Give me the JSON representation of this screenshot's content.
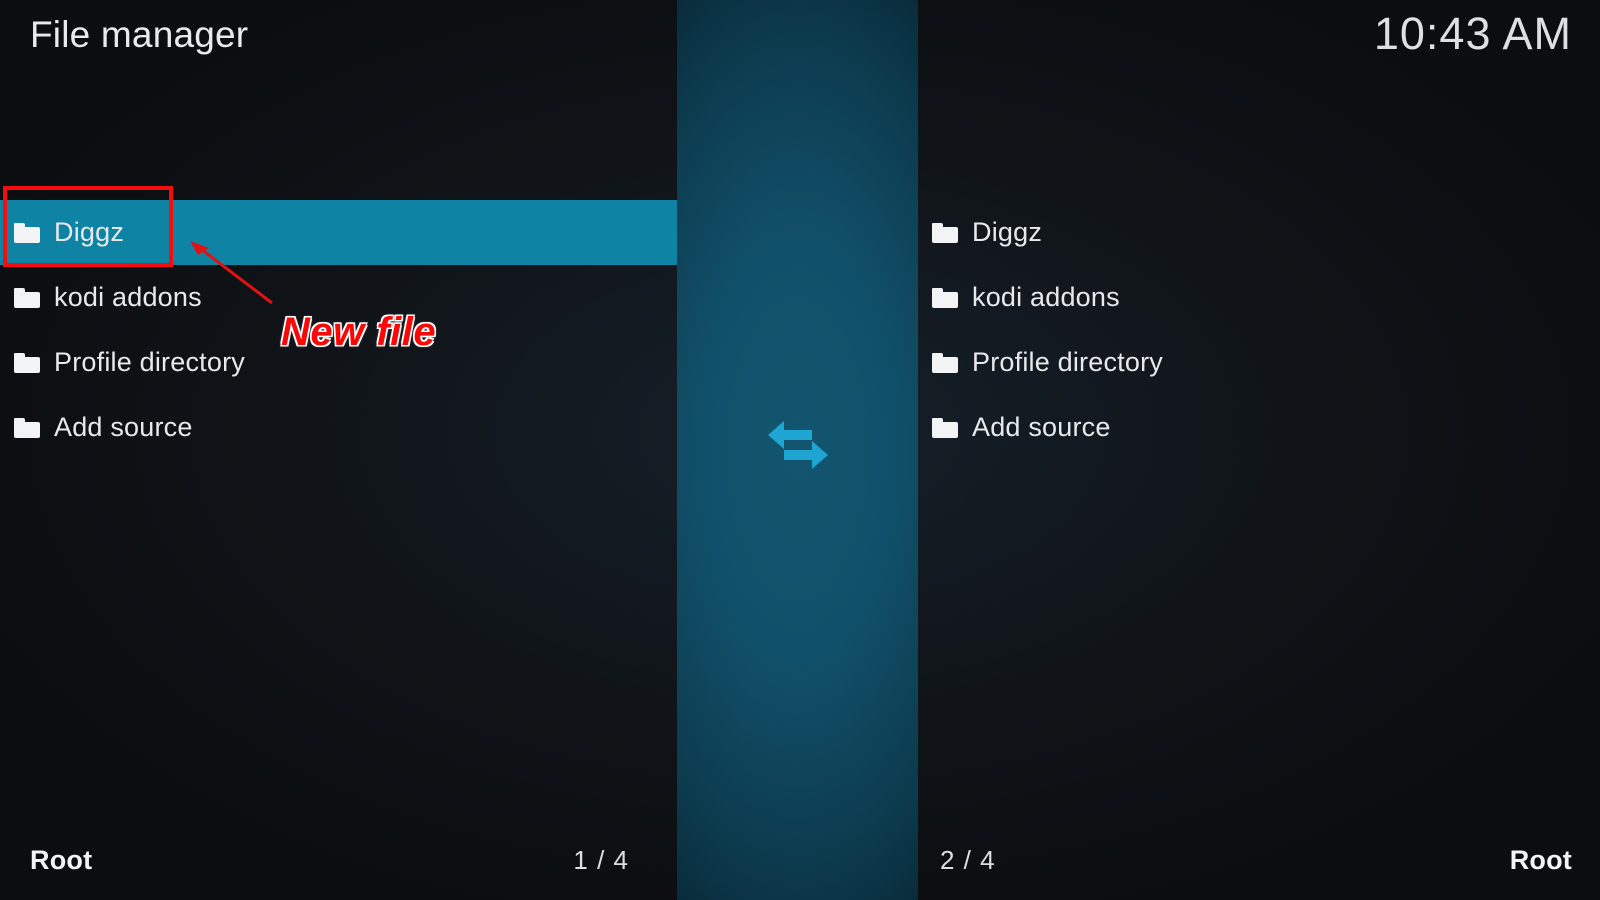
{
  "header": {
    "title": "File manager",
    "clock": "10:43 AM"
  },
  "colors": {
    "selection": "#0e83a3",
    "divider_accent": "#11506a",
    "arrow_icon": "#1fa5d2",
    "annotation": "#fa0808",
    "background": "#101418",
    "text": "#e8e9eb"
  },
  "panels": {
    "left": {
      "items": [
        {
          "label": "Diggz",
          "icon": "folder-icon",
          "selected": true
        },
        {
          "label": "kodi addons",
          "icon": "folder-icon",
          "selected": false
        },
        {
          "label": "Profile directory",
          "icon": "folder-icon",
          "selected": false
        },
        {
          "label": "Add source",
          "icon": "folder-icon",
          "selected": false
        }
      ],
      "footer": {
        "path": "Root",
        "count": "1 / 4"
      }
    },
    "right": {
      "items": [
        {
          "label": "Diggz",
          "icon": "folder-icon",
          "selected": false
        },
        {
          "label": "kodi addons",
          "icon": "folder-icon",
          "selected": false
        },
        {
          "label": "Profile directory",
          "icon": "folder-icon",
          "selected": false
        },
        {
          "label": "Add source",
          "icon": "folder-icon",
          "selected": false
        }
      ],
      "footer": {
        "path": "Root",
        "count": "2 / 4"
      }
    }
  },
  "divider": {
    "icon": "swap-panels-arrows-icon"
  },
  "annotations": {
    "highlight_box_target": "Diggz",
    "arrow_label": "New file"
  }
}
